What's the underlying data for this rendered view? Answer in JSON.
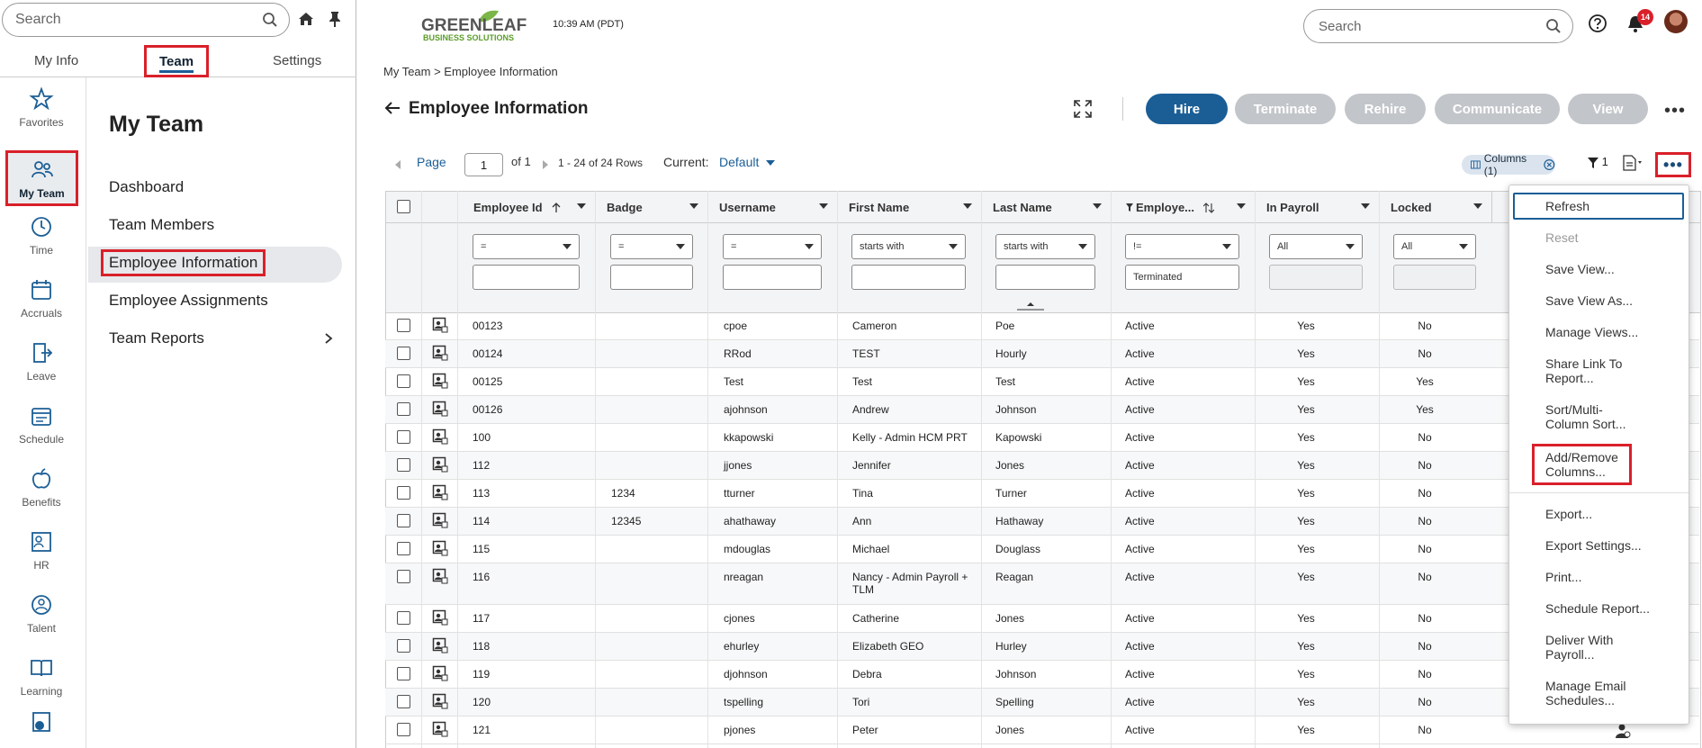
{
  "left_panel": {
    "search_placeholder": "Search",
    "tabs": [
      "My Info",
      "Team",
      "Settings"
    ],
    "rail": [
      "Favorites",
      "My Team",
      "Time",
      "Accruals",
      "Leave",
      "Schedule",
      "Benefits",
      "HR",
      "Talent",
      "Learning"
    ],
    "nav_title": "My Team",
    "nav_items": [
      "Dashboard",
      "Team Members",
      "Employee Information",
      "Employee Assignments",
      "Team Reports"
    ]
  },
  "header": {
    "logo_line1": "GREENLEAF",
    "logo_line2": "BUSINESS SOLUTIONS",
    "time": "10:39 AM (PDT)",
    "search_placeholder": "Search",
    "notification_count": "14"
  },
  "breadcrumb": "My Team  >  Employee Information",
  "page_title": "Employee Information",
  "actions": [
    "Hire",
    "Terminate",
    "Rehire",
    "Communicate",
    "View"
  ],
  "toolbar": {
    "page_label": "Page",
    "page_value": "1",
    "of_label": "of 1",
    "rows_label": "1 - 24 of 24 Rows",
    "current_label": "Current:",
    "current_view": "Default",
    "columns_chip": "Columns (1)",
    "filter_count": "1"
  },
  "columns": [
    "Employee Id",
    "Badge",
    "Username",
    "First Name",
    "Last Name",
    "Employe...",
    "In Payroll",
    "Locked"
  ],
  "filters": {
    "ops": [
      "=",
      "=",
      "=",
      "starts with",
      "starts with",
      "!=",
      "All",
      "All"
    ],
    "status_value": "Terminated"
  },
  "rows": [
    {
      "id": "00123",
      "badge": "",
      "user": "cpoe",
      "first": "Cameron",
      "last": "Poe",
      "status": "Active",
      "payroll": "Yes",
      "locked": "No"
    },
    {
      "id": "00124",
      "badge": "",
      "user": "RRod",
      "first": "TEST",
      "last": "Hourly",
      "status": "Active",
      "payroll": "Yes",
      "locked": "No"
    },
    {
      "id": "00125",
      "badge": "",
      "user": "Test",
      "first": "Test",
      "last": "Test",
      "status": "Active",
      "payroll": "Yes",
      "locked": "Yes"
    },
    {
      "id": "00126",
      "badge": "",
      "user": "ajohnson",
      "first": "Andrew",
      "last": "Johnson",
      "status": "Active",
      "payroll": "Yes",
      "locked": "Yes"
    },
    {
      "id": "100",
      "badge": "",
      "user": "kkapowski",
      "first": "Kelly - Admin HCM PRT",
      "last": "Kapowski",
      "status": "Active",
      "payroll": "Yes",
      "locked": "No"
    },
    {
      "id": "112",
      "badge": "",
      "user": "jjones",
      "first": "Jennifer",
      "last": "Jones",
      "status": "Active",
      "payroll": "Yes",
      "locked": "No"
    },
    {
      "id": "113",
      "badge": "1234",
      "user": "tturner",
      "first": "Tina",
      "last": "Turner",
      "status": "Active",
      "payroll": "Yes",
      "locked": "No"
    },
    {
      "id": "114",
      "badge": "12345",
      "user": "ahathaway",
      "first": "Ann",
      "last": "Hathaway",
      "status": "Active",
      "payroll": "Yes",
      "locked": "No"
    },
    {
      "id": "115",
      "badge": "",
      "user": "mdouglas",
      "first": "Michael",
      "last": "Douglass",
      "status": "Active",
      "payroll": "Yes",
      "locked": "No"
    },
    {
      "id": "116",
      "badge": "",
      "user": "nreagan",
      "first": "Nancy - Admin Payroll +",
      "first2": "TLM",
      "last": "Reagan",
      "status": "Active",
      "payroll": "Yes",
      "locked": "No"
    },
    {
      "id": "117",
      "badge": "",
      "user": "cjones",
      "first": "Catherine",
      "last": "Jones",
      "status": "Active",
      "payroll": "Yes",
      "locked": "No"
    },
    {
      "id": "118",
      "badge": "",
      "user": "ehurley",
      "first": "Elizabeth GEO",
      "last": "Hurley",
      "status": "Active",
      "payroll": "Yes",
      "locked": "No"
    },
    {
      "id": "119",
      "badge": "",
      "user": "djohnson",
      "first": "Debra",
      "last": "Johnson",
      "status": "Active",
      "payroll": "Yes",
      "locked": "No"
    },
    {
      "id": "120",
      "badge": "",
      "user": "tspelling",
      "first": "Tori",
      "last": "Spelling",
      "status": "Active",
      "payroll": "Yes",
      "locked": "No"
    },
    {
      "id": "121",
      "badge": "",
      "user": "pjones",
      "first": "Peter",
      "last": "Jones",
      "status": "Active",
      "payroll": "Yes",
      "locked": "No"
    }
  ],
  "menu": [
    [
      "Refresh"
    ],
    [
      "Reset"
    ],
    [
      "Save View..."
    ],
    [
      "Save View As..."
    ],
    [
      "Manage Views..."
    ],
    [
      "Share Link To",
      "Report..."
    ],
    [
      "Sort/Multi-",
      "Column Sort..."
    ],
    [
      "Add/Remove",
      "Columns..."
    ],
    [
      "Export..."
    ],
    [
      "Export Settings..."
    ],
    [
      "Print..."
    ],
    [
      "Schedule Report..."
    ],
    [
      "Deliver With",
      "Payroll..."
    ],
    [
      "Manage Email",
      "Schedules..."
    ]
  ],
  "colors": {
    "accent": "#1b5e96",
    "highlight": "#d9202a",
    "disabled_button": "#c2c5c9"
  }
}
